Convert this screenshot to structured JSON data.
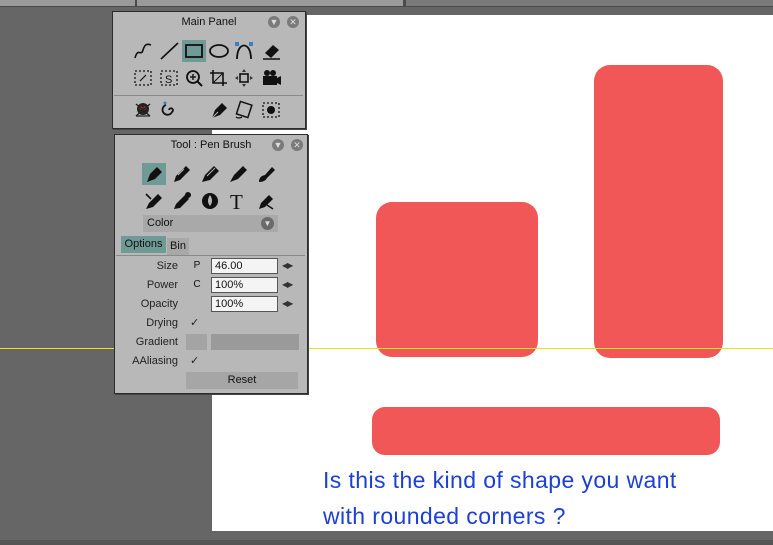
{
  "main_panel": {
    "title": "Main Panel",
    "tools_row1": [
      "freehand-icon",
      "line-icon",
      "rectangle-icon",
      "ellipse-icon",
      "bezier-icon",
      "eraser-icon"
    ],
    "tools_row2": [
      "lasso-select-icon",
      "select-s-icon",
      "zoom-icon",
      "crop-icon",
      "move-icon",
      "camera-icon"
    ],
    "tools_row3": [
      "skull-icon",
      "spiral-icon",
      "pen-nib-icon",
      "rotate-paper-icon",
      "texture-icon"
    ]
  },
  "tool_panel": {
    "title": "Tool : Pen Brush",
    "tools_row1": [
      "pen-brush-icon",
      "pencil-icon",
      "marker-icon",
      "brush-icon",
      "airbrush-icon"
    ],
    "tools_row2": [
      "smudge-icon",
      "dropper-icon",
      "water-drop-icon",
      "text-tool-icon",
      "fill-pen-icon"
    ],
    "color_label": "Color",
    "tabs": [
      "Options",
      "Bin"
    ],
    "size_label": "Size",
    "size_flag": "P",
    "size_value": "46.00",
    "power_label": "Power",
    "power_flag": "C",
    "power_value": "100%",
    "opacity_label": "Opacity",
    "opacity_value": "100%",
    "drying_label": "Drying",
    "gradient_label": "Gradient",
    "aaliasing_label": "AAliasing",
    "reset_label": "Reset"
  },
  "canvas": {
    "message_line1": "Is this the kind of shape you want",
    "message_line2": "with rounded corners ?",
    "shape_color": "#f25757",
    "text_color": "#1c3fd6"
  }
}
